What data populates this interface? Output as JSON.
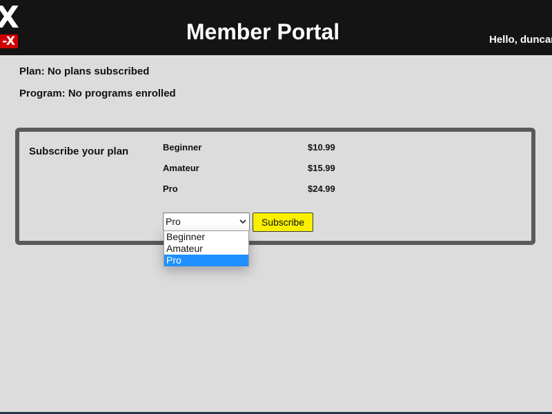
{
  "header": {
    "logo_big": "X",
    "logo_small": "-X",
    "title": "Member Portal",
    "greeting": "Hello, duncan"
  },
  "status": {
    "plan": "Plan: No plans subscribed",
    "program": "Program: No programs enrolled"
  },
  "subscribe": {
    "label": "Subscribe your plan",
    "plans": [
      {
        "name": "Beginner",
        "price": "$10.99"
      },
      {
        "name": "Amateur",
        "price": "$15.99"
      },
      {
        "name": "Pro",
        "price": "$24.99"
      }
    ],
    "select": {
      "selected": "Pro",
      "options": [
        "Beginner",
        "Amateur",
        "Pro"
      ]
    },
    "button_label": "Subscribe"
  },
  "colors": {
    "header_bg": "#141414",
    "page_bg": "#dcdcdc",
    "logo_red": "#d10000",
    "button_yellow": "#f8f000",
    "option_highlight": "#1e90ff"
  }
}
